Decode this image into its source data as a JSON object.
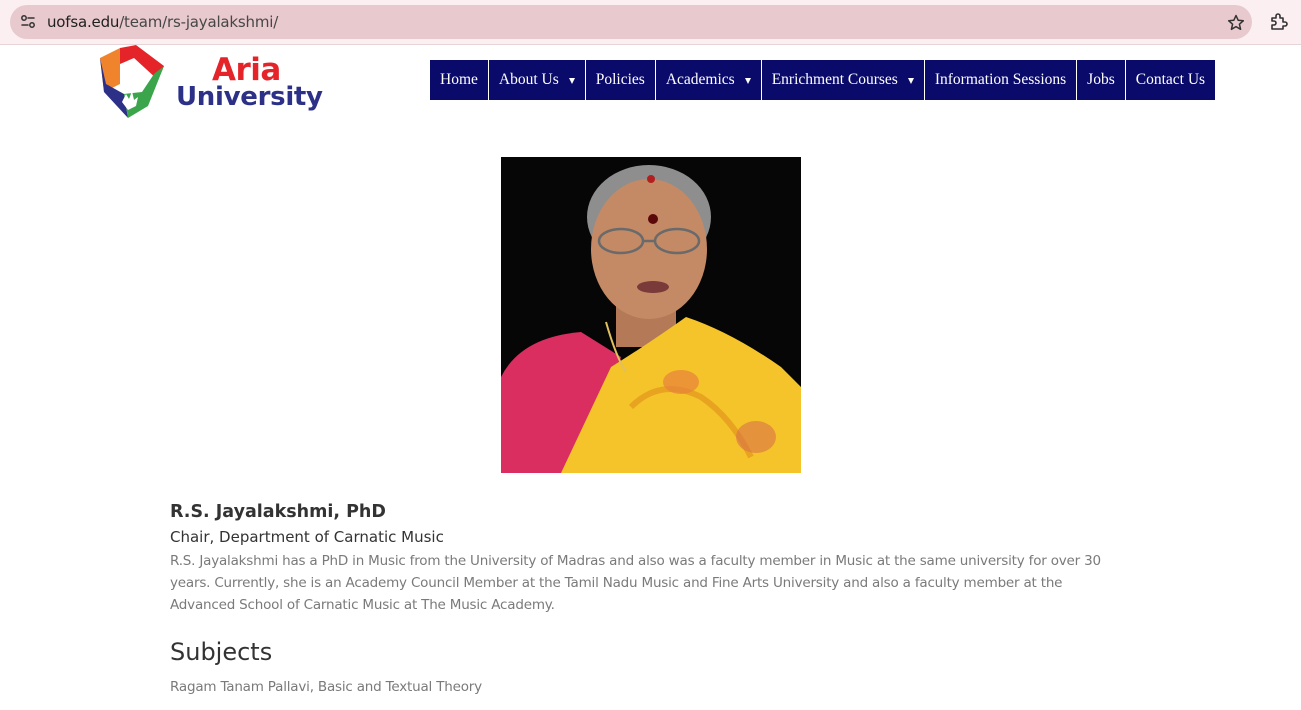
{
  "browser": {
    "url_domain": "uofsa.edu",
    "url_path": "/team/rs-jayalakshmi/"
  },
  "logo": {
    "line1": "Aria",
    "line2": "University",
    "colors": {
      "red": "#e5242a",
      "navy": "#2d3087",
      "orange": "#f0842c",
      "green": "#3aa54a"
    }
  },
  "nav": {
    "items": [
      {
        "label": "Home",
        "has_dropdown": false
      },
      {
        "label": "About Us",
        "has_dropdown": true
      },
      {
        "label": "Policies",
        "has_dropdown": false
      },
      {
        "label": "Academics",
        "has_dropdown": true
      },
      {
        "label": "Enrichment Courses",
        "has_dropdown": true
      },
      {
        "label": "Information Sessions",
        "has_dropdown": false
      },
      {
        "label": "Jobs",
        "has_dropdown": false
      },
      {
        "label": "Contact Us",
        "has_dropdown": false
      }
    ],
    "background": "#0a0a6b"
  },
  "profile": {
    "name": "R.S. Jayalakshmi, PhD",
    "role": "Chair, Department of Carnatic Music",
    "bio": "R.S. Jayalakshmi has a PhD in Music from the University of Madras and also was a faculty member in Music at the same university for over 30 years. Currently, she is an Academy Council Member at the Tamil Nadu Music and Fine Arts University and also a faculty member at the Advanced School of Carnatic Music at The Music Academy.",
    "subjects_heading": "Subjects",
    "subjects": "Ragam Tanam Pallavi, Basic and Textual Theory"
  },
  "icons": [
    "site-info-icon",
    "bookmark-star-icon",
    "extensions-icon",
    "dropdown-caret-icon"
  ]
}
